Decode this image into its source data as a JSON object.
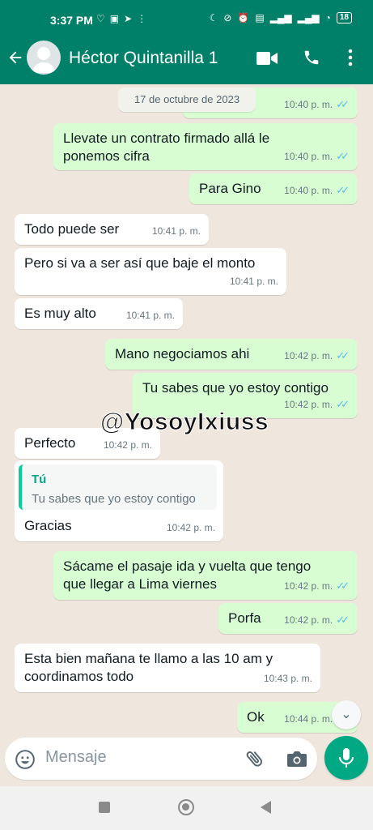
{
  "status_bar": {
    "time": "3:37 PM",
    "battery": "18",
    "left_icons": [
      "heart-pulse-icon",
      "gallery-icon",
      "telegram-icon",
      "more-dots-icon"
    ],
    "right_icons": [
      "moon-icon",
      "mute-icon",
      "alarm-icon",
      "volte-icon",
      "signal-icon",
      "signal-icon",
      "wifi-icon",
      "battery-icon"
    ]
  },
  "header": {
    "contact_name": "Héctor Quintanilla 1",
    "icons": [
      "back-arrow-icon",
      "avatar",
      "video-call-icon",
      "phone-icon",
      "more-vertical-icon"
    ]
  },
  "date_chip": "17 de octubre de 2023",
  "partial_top_message": {
    "text": "...",
    "time": "10:40 p. m."
  },
  "messages": [
    {
      "dir": "out",
      "lines": [
        "Llevate un contrato firmado allá le",
        "ponemos cifra"
      ],
      "time": "10:40 p. m."
    },
    {
      "dir": "out",
      "lines": [
        "Para Gino"
      ],
      "time": "10:40 p. m."
    },
    {
      "dir": "in",
      "lines": [
        "Todo puede ser"
      ],
      "time": "10:41 p. m."
    },
    {
      "dir": "in",
      "lines": [
        "Pero si va a ser así que baje el monto"
      ],
      "time": "10:41 p. m."
    },
    {
      "dir": "in",
      "lines": [
        "Es muy alto"
      ],
      "time": "10:41 p. m."
    },
    {
      "dir": "out",
      "lines": [
        "Mano negociamos ahi"
      ],
      "time": "10:42 p. m."
    },
    {
      "dir": "out",
      "lines": [
        "Tu sabes que yo estoy contigo"
      ],
      "time": "10:42 p. m."
    },
    {
      "dir": "in",
      "lines": [
        "Perfecto"
      ],
      "time": "10:42 p. m."
    },
    {
      "dir": "in",
      "quote_author": "Tú",
      "quote_text": "Tu sabes que yo estoy contigo",
      "lines": [
        "Gracias"
      ],
      "time": "10:42 p. m."
    },
    {
      "dir": "out",
      "lines": [
        "Sácame el pasaje ida y vuelta que tengo",
        "que llegar a Lima viernes"
      ],
      "time": "10:42 p. m."
    },
    {
      "dir": "out",
      "lines": [
        "Porfa"
      ],
      "time": "10:42 p. m."
    },
    {
      "dir": "in",
      "lines": [
        "Esta bien mañana te llamo a las 10 am y",
        "coordinamos todo"
      ],
      "time": "10:43 p. m."
    },
    {
      "dir": "out",
      "lines": [
        "Ok"
      ],
      "time": "10:44 p. m."
    }
  ],
  "watermark": "@YosoyIxiuss",
  "composer": {
    "placeholder": "Mensaje",
    "icons": [
      "emoji-icon",
      "attach-icon",
      "camera-icon",
      "mic-icon"
    ]
  },
  "colors": {
    "header": "#008069",
    "outgoing_bubble": "#d9fdd3",
    "incoming_bubble": "#ffffff",
    "chat_bg": "#efe7de",
    "read_ticks": "#53bdeb",
    "accent": "#00a884"
  }
}
